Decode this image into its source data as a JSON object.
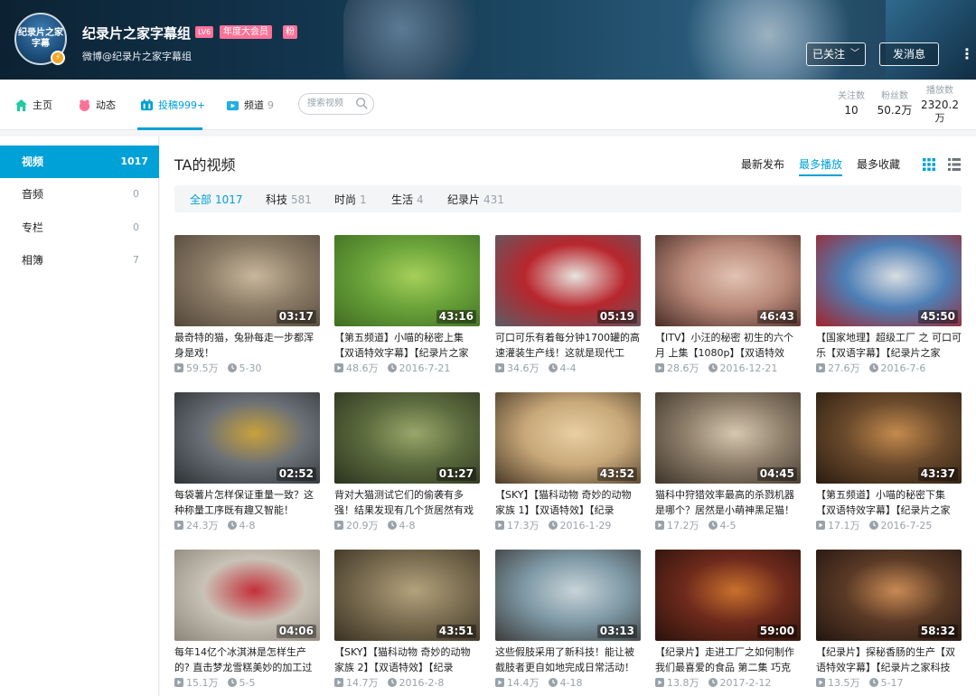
{
  "header": {
    "avatar_text": "纪录片之家字幕",
    "username": "纪录片之家字幕组",
    "level": "LV6",
    "vip_badge": "年度大会员",
    "extra_badge": "粉",
    "signature": "微博@纪录片之家字幕组",
    "followed_label": "已关注",
    "message_label": "发消息",
    "more_label": "⋮"
  },
  "nav": {
    "home": "主页",
    "dynamic": "动态",
    "uploads": "投稿",
    "uploads_count": "999+",
    "channels": "频道",
    "channels_count": "9",
    "search_placeholder": "搜索视频"
  },
  "stats": {
    "following_label": "关注数",
    "following": "10",
    "fans_label": "粉丝数",
    "fans": "50.2万",
    "plays_label": "播放数",
    "plays_line1": "2320.2",
    "plays_line2": "万"
  },
  "sidebar": {
    "items": [
      {
        "label": "视频",
        "count": "1017"
      },
      {
        "label": "音频",
        "count": "0"
      },
      {
        "label": "专栏",
        "count": "0"
      },
      {
        "label": "相簿",
        "count": "7"
      }
    ]
  },
  "main": {
    "title": "TA的视频",
    "sort_options": [
      "最新发布",
      "最多播放",
      "最多收藏"
    ],
    "active_sort": "最多播放",
    "filters": [
      {
        "label": "全部",
        "count": "1017"
      },
      {
        "label": "科技",
        "count": "581"
      },
      {
        "label": "时尚",
        "count": "1"
      },
      {
        "label": "生活",
        "count": "4"
      },
      {
        "label": "纪录片",
        "count": "431"
      }
    ]
  },
  "videos": [
    {
      "duration": "03:17",
      "title": "最奇特的猫，兔狲每走一步都浑身是戏！",
      "plays": "59.5万",
      "date": "5-30",
      "colors": [
        "#8a7b66",
        "#c8b79c",
        "#54473a"
      ]
    },
    {
      "duration": "43:16",
      "title": "【第五频道】小喵的秘密上集【双语特效字幕】【纪录片之家",
      "plays": "48.6万",
      "date": "2016-7-21",
      "colors": [
        "#6aa33a",
        "#a6cf5a",
        "#3f6d22"
      ]
    },
    {
      "duration": "05:19",
      "title": "可口可乐有着每分钟1700罐的高速灌装生产线！这就是现代工",
      "plays": "34.6万",
      "date": "4-4",
      "colors": [
        "#b8262d",
        "#e7e4df",
        "#5a5e66"
      ]
    },
    {
      "duration": "46:43",
      "title": "【ITV】小汪的秘密 初生的六个月 上集【1080p】【双语特效",
      "plays": "28.6万",
      "date": "2016-12-21",
      "colors": [
        "#b98a7a",
        "#e2c2b3",
        "#4a2c26"
      ]
    },
    {
      "duration": "45:50",
      "title": "【国家地理】超级工厂 之 可口可乐【双语字幕】【纪录片之家",
      "plays": "27.6万",
      "date": "2016-7-6",
      "colors": [
        "#4d7fb5",
        "#d9dde2",
        "#a3232a"
      ]
    },
    {
      "duration": "02:52",
      "title": "每袋薯片怎样保证重量一致？这种称量工序既有趣又智能！",
      "plays": "24.3万",
      "date": "4-8",
      "colors": [
        "#6b7076",
        "#c9a13c",
        "#2e3236"
      ]
    },
    {
      "duration": "01:27",
      "title": "背对大猫测试它们的偷袭有多强！结果发现有几个货居然有戏",
      "plays": "20.9万",
      "date": "4-8",
      "colors": [
        "#5b6b3e",
        "#9aa66a",
        "#2c331f"
      ]
    },
    {
      "duration": "43:52",
      "title": "【SKY】【猫科动物 奇妙的动物家族 1】【双语特效】【纪录",
      "plays": "17.3万",
      "date": "2016-1-29",
      "colors": [
        "#c8a879",
        "#e8cfa3",
        "#4a3a28"
      ]
    },
    {
      "duration": "04:45",
      "title": "猫科中狩猎效率最高的杀戮机器是哪个？居然是小萌神黑足猫！",
      "plays": "17.2万",
      "date": "4-5",
      "colors": [
        "#8d7e6a",
        "#d6c7b0",
        "#3d342a"
      ]
    },
    {
      "duration": "43:37",
      "title": "【第五频道】小喵的秘密下集【双语特效字幕】【纪录片之家",
      "plays": "17.1万",
      "date": "2016-7-25",
      "colors": [
        "#6a4a2c",
        "#c48a4e",
        "#2a1c10"
      ]
    },
    {
      "duration": "04:06",
      "title": "每年14亿个冰淇淋是怎样生产的? 直击梦龙雪糕美妙的加工过",
      "plays": "15.1万",
      "date": "5-5",
      "colors": [
        "#c9c2b6",
        "#c4303a",
        "#8c857a"
      ]
    },
    {
      "duration": "43:51",
      "title": "【SKY】【猫科动物 奇妙的动物家族 2】【双语特效】【纪录",
      "plays": "14.7万",
      "date": "2016-2-8",
      "colors": [
        "#7b6e52",
        "#b3a27c",
        "#3a3222"
      ]
    },
    {
      "duration": "03:13",
      "title": "这些假肢采用了新科技！能让被截肢者更自如地完成日常活动！",
      "plays": "14.4万",
      "date": "4-18",
      "colors": [
        "#7f9aa6",
        "#c8d3d8",
        "#3c3c3c"
      ]
    },
    {
      "duration": "59:00",
      "title": "【纪录片】走进工厂之如何制作我们最喜爱的食品 第二集 巧克",
      "plays": "13.8万",
      "date": "2017-2-12",
      "colors": [
        "#6e2a1c",
        "#c9712c",
        "#2a120c"
      ]
    },
    {
      "duration": "58:32",
      "title": "【纪录片】探秘香肠的生产【双语特效字幕】【纪录片之家科技",
      "plays": "13.5万",
      "date": "5-17",
      "colors": [
        "#5a3a26",
        "#c98a54",
        "#231510"
      ]
    }
  ]
}
